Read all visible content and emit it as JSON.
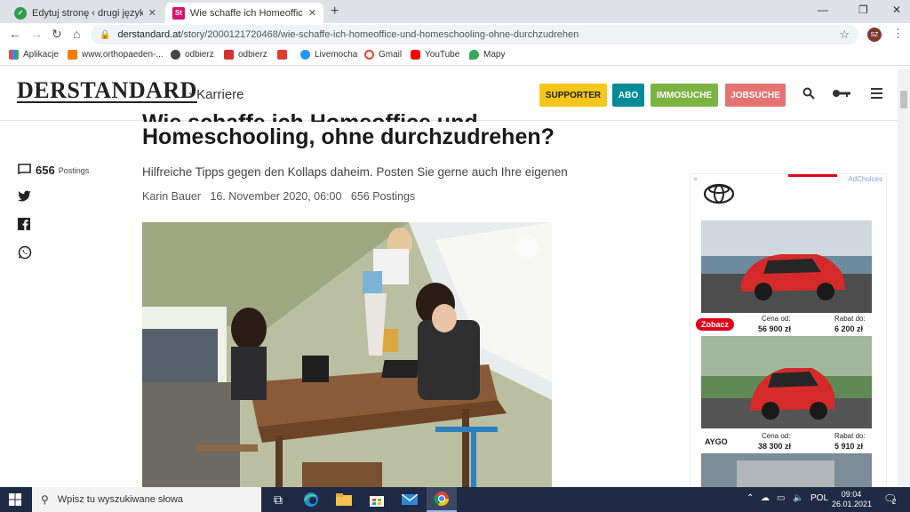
{
  "browser": {
    "tabs": [
      {
        "title": "Edytuj stronę ‹ drugi język - niem",
        "favicon": "green-check"
      },
      {
        "title": "Wie schaffe ich Homeoffice und H",
        "favicon": "St",
        "active": true
      }
    ],
    "url_domain": "derstandard.at",
    "url_path": "/story/2000121720468/wie-schaffe-ich-homeoffice-und-homeschooling-ohne-durchzudrehen",
    "avatar": "SZ",
    "bookmarks": [
      {
        "label": "Aplikacje",
        "color": "#e8453c"
      },
      {
        "label": "www.orthopaeden-...",
        "color": "#f57c00"
      },
      {
        "label": "odbierz",
        "color": "#444"
      },
      {
        "label": "odbierz",
        "color": "#d32f2f"
      },
      {
        "label": "",
        "color": "#e53935"
      },
      {
        "label": "Livemocha",
        "color": "#2196f3"
      },
      {
        "label": "Gmail",
        "color": "#ea4335"
      },
      {
        "label": "YouTube",
        "color": "#ff0000"
      },
      {
        "label": "Mapy",
        "color": "#34a853"
      }
    ]
  },
  "site": {
    "logo": "DERSTANDARD",
    "section": "› Karriere",
    "buttons": [
      {
        "label": "SUPPORTER",
        "bg": "#f5c518",
        "fg": "#222"
      },
      {
        "label": "ABO",
        "bg": "#008c95",
        "fg": "#fff"
      },
      {
        "label": "IMMOSUCHE",
        "bg": "#7cb342",
        "fg": "#fff"
      },
      {
        "label": "JOBSUCHE",
        "bg": "#e57373",
        "fg": "#fff"
      }
    ]
  },
  "article": {
    "title_cut": "Wie schaffe ich Homeoffice und",
    "title": "Homeschooling, ohne durchzudrehen?",
    "lead": "Hilfreiche Tipps gegen den Kollaps daheim. Posten Sie gerne auch Ihre eigenen",
    "author": "Karin Bauer",
    "date": "16. November 2020, 06:00",
    "postings_text": "656 Postings",
    "postings_count": "656",
    "postings_label": "Postings"
  },
  "ad": {
    "adchoices": "AdChoices",
    "row1": {
      "cta": "Zobacz",
      "price_label": "Cena od:",
      "price": "56 900 zł",
      "discount_label": "Rabat do:",
      "discount": "6 200 zł"
    },
    "row2": {
      "model": "AYGO",
      "price_label": "Cena od:",
      "price": "38 300 zł",
      "discount_label": "Rabat do:",
      "discount": "5 910 zł"
    }
  },
  "taskbar": {
    "search_placeholder": "Wpisz tu wyszukiwane słowa",
    "lang": "POL",
    "time": "09:04",
    "date": "26.01.2021",
    "notifications": "2"
  }
}
